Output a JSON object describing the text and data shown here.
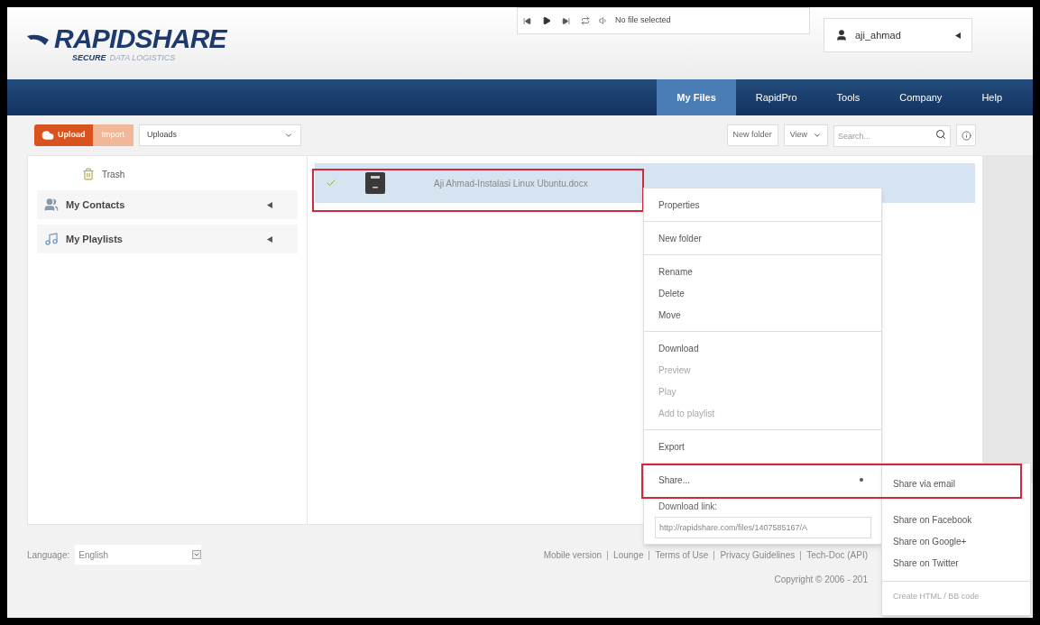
{
  "logo": {
    "name": "RAPIDSHARE",
    "tagline_bold": "SECURE",
    "tagline": "DATA LOGISTICS"
  },
  "player": {
    "status": "No file selected"
  },
  "user": {
    "name": "aji_ahmad"
  },
  "nav": [
    {
      "label": "My Files",
      "selected": true
    },
    {
      "label": "RapidPro",
      "selected": false
    },
    {
      "label": "Tools",
      "selected": false
    },
    {
      "label": "Company",
      "selected": false
    },
    {
      "label": "Help",
      "selected": false
    }
  ],
  "toolbar": {
    "upload": "Upload",
    "import": "Import",
    "folder": "Uploads",
    "new_folder": "New folder",
    "view": "View",
    "search_placeholder": "Search..."
  },
  "sidebar": {
    "trash": "Trash",
    "sections": [
      {
        "label": "My Contacts",
        "kind": "contacts"
      },
      {
        "label": "My Playlists",
        "kind": "playlists"
      }
    ]
  },
  "files": [
    {
      "name": "Aji Ahmad-Instalasi Linux Ubuntu.docx",
      "checked": true,
      "selected": true
    }
  ],
  "menu": {
    "groups": [
      [
        {
          "label": "Properties",
          "disabled": false
        }
      ],
      [
        {
          "label": "New folder",
          "disabled": false
        }
      ],
      [
        {
          "label": "Rename",
          "disabled": false
        },
        {
          "label": "Delete",
          "disabled": false
        },
        {
          "label": "Move",
          "disabled": false
        }
      ],
      [
        {
          "label": "Download",
          "disabled": false
        },
        {
          "label": "Preview",
          "disabled": true
        },
        {
          "label": "Play",
          "disabled": true
        },
        {
          "label": "Add to playlist",
          "disabled": true
        }
      ],
      [
        {
          "label": "Export",
          "disabled": false
        }
      ],
      [
        {
          "label": "Share...",
          "disabled": false,
          "submenu": true
        }
      ]
    ],
    "link_label": "Download link:",
    "link_value": "http://rapidshare.com/files/1407585167/A"
  },
  "submenu": {
    "items": [
      {
        "label": "Share via email",
        "disabled": false
      },
      {
        "label": "Share on Facebook",
        "disabled": false
      },
      {
        "label": "Share on Google+",
        "disabled": false
      },
      {
        "label": "Share on Twitter",
        "disabled": false
      }
    ],
    "footer": {
      "label": "Create HTML / BB code",
      "disabled": true
    }
  },
  "footer": {
    "language_label": "Language:",
    "language": "English",
    "links": [
      "Mobile version",
      "Lounge",
      "Terms of Use",
      "Privacy Guidelines",
      "Tech-Doc (API)"
    ],
    "copyright": "Copyright © 2006 - 201"
  }
}
